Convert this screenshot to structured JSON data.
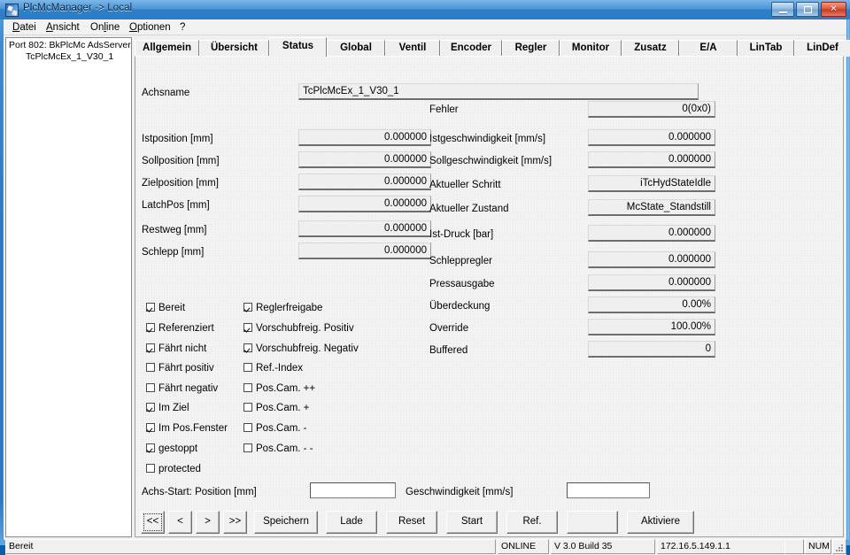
{
  "window": {
    "title": "PlcMcManager -> Local",
    "icon": "app-icon",
    "buttons": {
      "minimize": "minimize",
      "maximize": "maximize",
      "close": "✕"
    }
  },
  "menubar": {
    "items": [
      {
        "label": "Datei",
        "accel": "D"
      },
      {
        "label": "Ansicht",
        "accel": "A"
      },
      {
        "label": "Online",
        "accel": "l"
      },
      {
        "label": "Optionen",
        "accel": "O"
      },
      {
        "label": "?",
        "accel": ""
      }
    ]
  },
  "tree": {
    "root": "Port 802: BkPlcMc AdsServer",
    "child": "TcPlcMcEx_1_V30_1"
  },
  "tabs": [
    {
      "label": "Allgemein",
      "active": false
    },
    {
      "label": "Übersicht",
      "active": false
    },
    {
      "label": "Status",
      "active": true
    },
    {
      "label": "Global",
      "active": false
    },
    {
      "label": "Ventil",
      "active": false
    },
    {
      "label": "Encoder",
      "active": false
    },
    {
      "label": "Regler",
      "active": false
    },
    {
      "label": "Monitor",
      "active": false
    },
    {
      "label": "Zusatz",
      "active": false
    },
    {
      "label": "E/A",
      "active": false
    },
    {
      "label": "LinTab",
      "active": false
    },
    {
      "label": "LinDef",
      "active": false
    }
  ],
  "status_page": {
    "axis_name_label": "Achsname",
    "axis_name_value": "TcPlcMcEx_1_V30_1",
    "left_fields": [
      {
        "label": "Istposition [mm]",
        "value": "0.000000"
      },
      {
        "label": "Sollposition [mm]",
        "value": "0.000000"
      },
      {
        "label": "Zielposition [mm]",
        "value": "0.000000"
      },
      {
        "label": "LatchPos [mm]",
        "value": "0.000000"
      },
      {
        "label": "Restweg [mm]",
        "value": "0.000000"
      },
      {
        "label": "Schlepp [mm]",
        "value": "0.000000"
      }
    ],
    "right_fields": [
      {
        "label": "Fehler",
        "value": "0(0x0)",
        "align": "right"
      },
      {
        "label": "Istgeschwindigkeit [mm/s]",
        "value": "0.000000",
        "align": "right"
      },
      {
        "label": "Sollgeschwindigkeit [mm/s]",
        "value": "0.000000",
        "align": "right"
      },
      {
        "label": "Aktueller Schritt",
        "value": "iTcHydStateIdle",
        "align": "right"
      },
      {
        "label": "Aktueller Zustand",
        "value": "McState_Standstill",
        "align": "right"
      },
      {
        "label": "Ist-Druck [bar]",
        "value": "0.000000",
        "align": "right"
      },
      {
        "label": "Schleppregler",
        "value": "0.000000",
        "align": "right"
      },
      {
        "label": "Pressausgabe",
        "value": "0.000000",
        "align": "right"
      },
      {
        "label": "Überdeckung",
        "value": "0.00%",
        "align": "right"
      },
      {
        "label": "Override",
        "value": "100.00%",
        "align": "right"
      },
      {
        "label": "Buffered",
        "value": "0",
        "align": "right"
      }
    ],
    "checkboxes_col1": [
      {
        "label": "Bereit",
        "checked": true
      },
      {
        "label": "Referenziert",
        "checked": true
      },
      {
        "label": "Fährt nicht",
        "checked": true
      },
      {
        "label": "Fährt positiv",
        "checked": false
      },
      {
        "label": "Fährt negativ",
        "checked": false
      },
      {
        "label": "Im Ziel",
        "checked": true
      },
      {
        "label": "Im Pos.Fenster",
        "checked": true
      },
      {
        "label": "gestoppt",
        "checked": true
      },
      {
        "label": "protected",
        "checked": false
      }
    ],
    "checkboxes_col2": [
      {
        "label": "Reglerfreigabe",
        "checked": true
      },
      {
        "label": "Vorschubfreig. Positiv",
        "checked": true
      },
      {
        "label": "Vorschubfreig. Negativ",
        "checked": true
      },
      {
        "label": "Ref.-Index",
        "checked": false
      },
      {
        "label": "Pos.Cam. ++",
        "checked": false
      },
      {
        "label": "Pos.Cam. +",
        "checked": false
      },
      {
        "label": "Pos.Cam. -",
        "checked": false
      },
      {
        "label": "Pos.Cam. - -",
        "checked": false
      }
    ],
    "start_row": {
      "position_label": "Achs-Start: Position [mm]",
      "position_value": "",
      "position_placeholder": "",
      "velocity_label": "Geschwindigkeit [mm/s]",
      "velocity_value": "",
      "velocity_placeholder": ""
    },
    "buttons": [
      {
        "label": "<<",
        "name": "first-button",
        "focus": true
      },
      {
        "label": "<",
        "name": "prev-button",
        "focus": false
      },
      {
        "label": ">",
        "name": "next-button",
        "focus": false
      },
      {
        "label": ">>",
        "name": "last-button",
        "focus": false
      },
      {
        "label": "Speichern",
        "name": "save-button",
        "focus": false
      },
      {
        "label": "Lade",
        "name": "load-button",
        "focus": false
      },
      {
        "label": "Reset",
        "name": "reset-button",
        "focus": false
      },
      {
        "label": "Start",
        "name": "start-button",
        "focus": false
      },
      {
        "label": "Ref.",
        "name": "ref-button",
        "focus": false
      },
      {
        "label": "",
        "name": "blank-button",
        "focus": false
      },
      {
        "label": "Aktiviere",
        "name": "activate-button",
        "focus": false
      }
    ]
  },
  "statusbar": {
    "message": "Bereit",
    "online": "ONLINE",
    "version": "V 3.0 Build 35",
    "address": "172.16.5.149.1.1",
    "caps": "",
    "num": "NUM",
    "scrl": ""
  },
  "colors": {
    "window_frame": "#2f79c0",
    "client_bg": "#f0f0f0",
    "field_bg": "#efefef",
    "close_button": "#c23b22"
  }
}
